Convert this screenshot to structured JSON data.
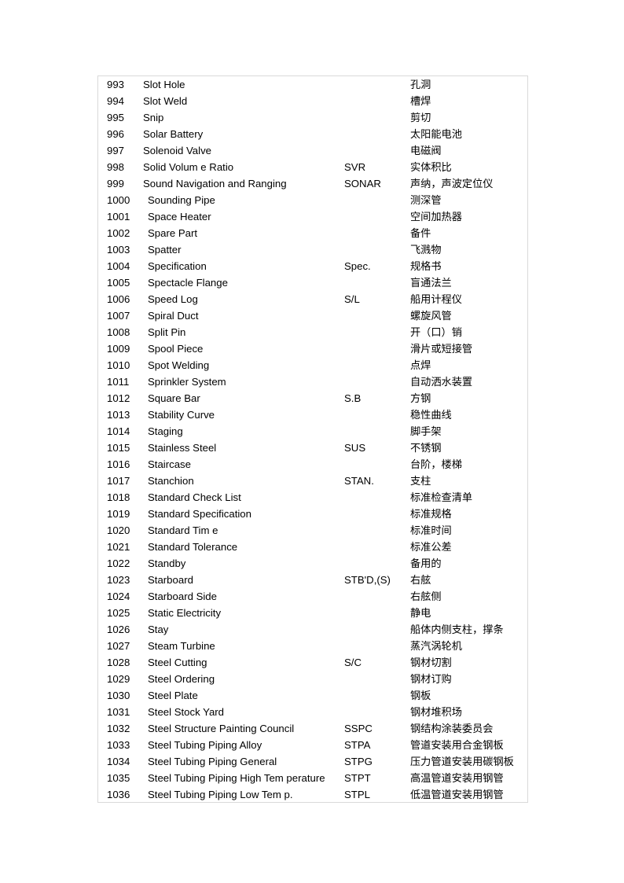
{
  "document": {
    "type": "glossary-table",
    "columns": [
      "index",
      "term",
      "abbreviation",
      "gloss"
    ],
    "rows": [
      {
        "index": "993",
        "term": "Slot Hole",
        "abbr": "",
        "gloss": "孔洞"
      },
      {
        "index": "994",
        "term": "Slot Weld",
        "abbr": "",
        "gloss": "槽焊"
      },
      {
        "index": "995",
        "term": "Snip",
        "abbr": "",
        "gloss": "剪切"
      },
      {
        "index": "996",
        "term": "Solar Battery",
        "abbr": "",
        "gloss": "太阳能电池"
      },
      {
        "index": "997",
        "term": "Solenoid Valve",
        "abbr": "",
        "gloss": "电磁阀"
      },
      {
        "index": "998",
        "term": "Solid Volum e Ratio",
        "abbr": "SVR",
        "gloss": "实体积比"
      },
      {
        "index": "999",
        "term": "Sound Navigation and Ranging",
        "abbr": "SONAR",
        "gloss": "声纳，声波定位仪"
      },
      {
        "index": "1000",
        "term": "Sounding Pipe",
        "abbr": "",
        "gloss": "测深管"
      },
      {
        "index": "1001",
        "term": "Space Heater",
        "abbr": "",
        "gloss": "空间加热器"
      },
      {
        "index": "1002",
        "term": "Spare Part",
        "abbr": "",
        "gloss": "备件"
      },
      {
        "index": "1003",
        "term": "Spatter",
        "abbr": "",
        "gloss": "飞溅物"
      },
      {
        "index": "1004",
        "term": "Specification",
        "abbr": "Spec.",
        "gloss": "规格书"
      },
      {
        "index": "1005",
        "term": "Spectacle Flange",
        "abbr": "",
        "gloss": "盲通法兰"
      },
      {
        "index": "1006",
        "term": "Speed Log",
        "abbr": "S/L",
        "gloss": "船用计程仪"
      },
      {
        "index": "1007",
        "term": "Spiral Duct",
        "abbr": "",
        "gloss": "螺旋风管"
      },
      {
        "index": "1008",
        "term": "Split Pin",
        "abbr": "",
        "gloss": "开（口）销"
      },
      {
        "index": "1009",
        "term": "Spool Piece",
        "abbr": "",
        "gloss": "滑片或短接管"
      },
      {
        "index": "1010",
        "term": "Spot Welding",
        "abbr": "",
        "gloss": "点焊"
      },
      {
        "index": "1011",
        "term": "Sprinkler System",
        "abbr": "",
        "gloss": "自动洒水装置"
      },
      {
        "index": "1012",
        "term": "Square Bar",
        "abbr": "S.B",
        "gloss": "方钢"
      },
      {
        "index": "1013",
        "term": "Stability Curve",
        "abbr": "",
        "gloss": "稳性曲线"
      },
      {
        "index": "1014",
        "term": "Staging",
        "abbr": "",
        "gloss": "脚手架"
      },
      {
        "index": "1015",
        "term": "Stainless Steel",
        "abbr": "SUS",
        "gloss": "不锈钢"
      },
      {
        "index": "1016",
        "term": "Staircase",
        "abbr": "",
        "gloss": "台阶，楼梯"
      },
      {
        "index": "1017",
        "term": "Stanchion",
        "abbr": "STAN.",
        "gloss": "支柱"
      },
      {
        "index": "1018",
        "term": "Standard Check List",
        "abbr": "",
        "gloss": "标准检查清单"
      },
      {
        "index": "1019",
        "term": "Standard Specification",
        "abbr": "",
        "gloss": "标准规格"
      },
      {
        "index": "1020",
        "term": "Standard Tim e",
        "abbr": "",
        "gloss": "标准时间"
      },
      {
        "index": "1021",
        "term": "Standard Tolerance",
        "abbr": "",
        "gloss": "标准公差"
      },
      {
        "index": "1022",
        "term": "Standby",
        "abbr": "",
        "gloss": "备用的"
      },
      {
        "index": "1023",
        "term": "Starboard",
        "abbr": "STB'D,(S)",
        "gloss": "右舷"
      },
      {
        "index": "1024",
        "term": "Starboard Side",
        "abbr": "",
        "gloss": "右舷侧"
      },
      {
        "index": "1025",
        "term": "Static Electricity",
        "abbr": "",
        "gloss": "静电"
      },
      {
        "index": "1026",
        "term": "Stay",
        "abbr": "",
        "gloss": "船体内侧支柱，撑条"
      },
      {
        "index": "1027",
        "term": "Steam Turbine",
        "abbr": "",
        "gloss": "蒸汽涡轮机"
      },
      {
        "index": "1028",
        "term": "Steel Cutting",
        "abbr": "S/C",
        "gloss": "钢材切割"
      },
      {
        "index": "1029",
        "term": "Steel Ordering",
        "abbr": "",
        "gloss": "钢材订购"
      },
      {
        "index": "1030",
        "term": "Steel Plate",
        "abbr": "",
        "gloss": "钢板"
      },
      {
        "index": "1031",
        "term": "Steel Stock Yard",
        "abbr": "",
        "gloss": "钢材堆积场"
      },
      {
        "index": "1032",
        "term": "Steel Structure Painting Council",
        "abbr": "SSPC",
        "gloss": "钢结构涂装委员会"
      },
      {
        "index": "1033",
        "term": "Steel Tubing Piping Alloy",
        "abbr": "STPA",
        "gloss": "管道安装用合金钢板"
      },
      {
        "index": "1034",
        "term": "Steel Tubing Piping General",
        "abbr": "STPG",
        "gloss": "压力管道安装用碳钢板"
      },
      {
        "index": "1035",
        "term": "Steel Tubing Piping High Tem perature",
        "abbr": "STPT",
        "gloss": "高温管道安装用钢管"
      },
      {
        "index": "1036",
        "term": "Steel Tubing Piping Low Tem p.",
        "abbr": "STPL",
        "gloss": "低温管道安装用钢管"
      }
    ]
  }
}
